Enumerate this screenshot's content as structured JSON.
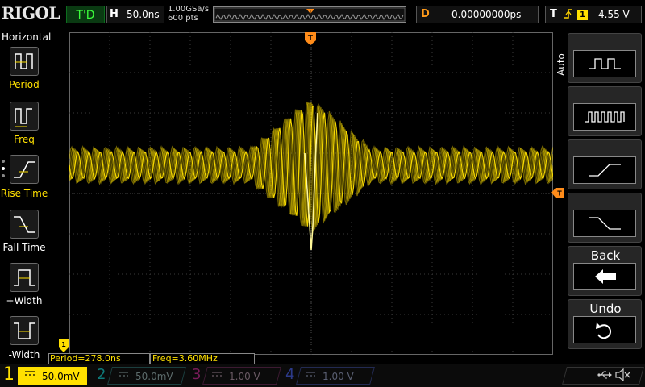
{
  "header": {
    "logo": "RIGOL",
    "run_state": "T'D",
    "horizontal_letter": "H",
    "timebase": "50.0ns",
    "sample_rate": "1.00GSa/s",
    "memory_depth": "600 pts",
    "delay_letter": "D",
    "delay": "0.00000000ps",
    "trigger_letter": "T",
    "trigger_edge_icon": "rising-edge-icon",
    "trigger_source": "1",
    "trigger_level": "4.55 V"
  },
  "left_menu": {
    "title": "Horizontal",
    "items": [
      {
        "label": "Period",
        "icon": "period-icon"
      },
      {
        "label": "Freq",
        "icon": "frequency-icon"
      },
      {
        "label": "Rise Time",
        "icon": "rise-time-icon"
      },
      {
        "label": "Fall Time",
        "icon": "fall-time-icon"
      },
      {
        "label": "+Width",
        "icon": "positive-width-icon"
      },
      {
        "label": "-Width",
        "icon": "negative-width-icon"
      }
    ]
  },
  "right_menu": {
    "mode": "Auto",
    "items": [
      {
        "icon": "square-wave-icon"
      },
      {
        "icon": "pulse-train-icon"
      },
      {
        "icon": "rising-edge-icon"
      },
      {
        "icon": "falling-edge-icon"
      },
      {
        "label": "Back",
        "icon": "back-arrow-icon"
      },
      {
        "label": "Undo",
        "icon": "undo-icon"
      }
    ]
  },
  "markers": {
    "trigger_pos": "T",
    "trigger_level": "T",
    "channel1": "1"
  },
  "measurements": {
    "period": "Period=278.0ns",
    "freq": "Freq=3.60MHz"
  },
  "channels": [
    {
      "num": "1",
      "scale": "50.0mV",
      "color": "#ffe000",
      "active": true
    },
    {
      "num": "2",
      "scale": "50.0mV",
      "color": "#0e7b7b",
      "active": false
    },
    {
      "num": "3",
      "scale": "1.00 V",
      "color": "#7a1c5a",
      "active": false
    },
    {
      "num": "4",
      "scale": "1.00 V",
      "color": "#2c3a8a",
      "active": false
    }
  ],
  "status": {
    "usb_icon": "usb-icon",
    "sound_icon": "speaker-mute-icon"
  },
  "colors": {
    "trace": "#ffe000",
    "trigger_marker": "#ff8c1a",
    "grid": "#3a3a3a"
  }
}
